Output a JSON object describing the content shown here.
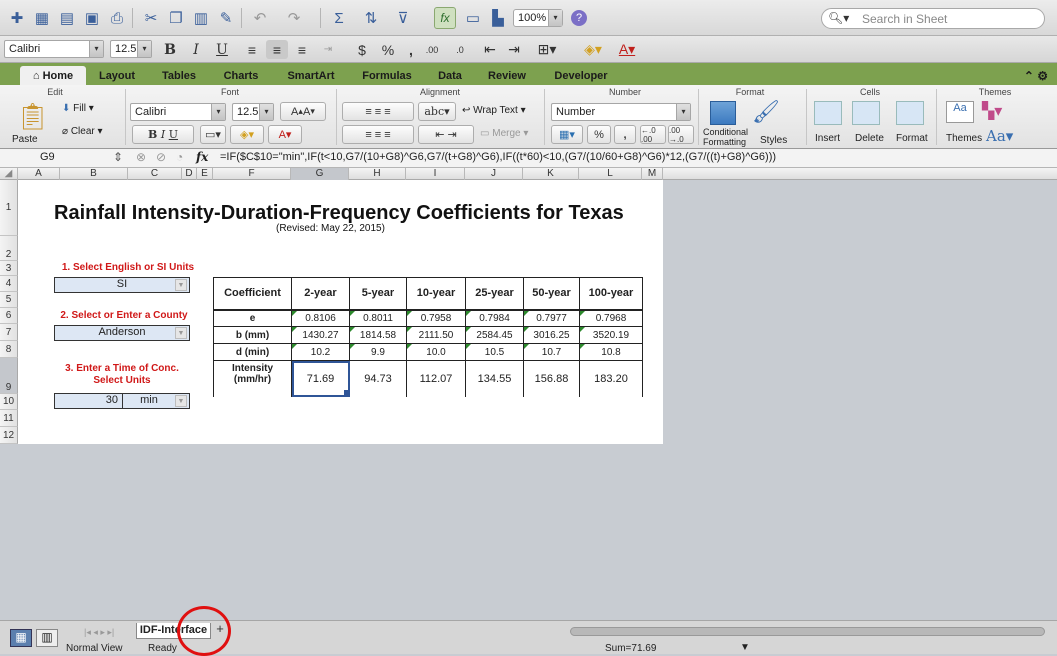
{
  "toolbar": {
    "zoom": "100%",
    "search_placeholder": "Search in Sheet"
  },
  "fontbar": {
    "font": "Calibri",
    "size": "12.5",
    "bold": "B",
    "italic": "I",
    "underline": "U"
  },
  "tabs": [
    "Home",
    "Layout",
    "Tables",
    "Charts",
    "SmartArt",
    "Formulas",
    "Data",
    "Review",
    "Developer"
  ],
  "ribbon": {
    "groups": {
      "edit": "Edit",
      "font": "Font",
      "alignment": "Alignment",
      "number": "Number",
      "format": "Format",
      "cells": "Cells",
      "themes": "Themes"
    },
    "fill": "Fill",
    "clear": "Clear",
    "paste": "Paste",
    "font": "Calibri",
    "size": "12.5",
    "abc": "abc",
    "wrap_text": "Wrap Text",
    "merge": "Merge",
    "number_format": "Number",
    "percent": "%",
    "comma": ",",
    "dec_inc": "←.0 .00",
    "dec_dec": ".00 →.0",
    "conditional": "Conditional Formatting",
    "styles": "Styles",
    "insert": "Insert",
    "delete": "Delete",
    "format": "Format",
    "themes": "Themes",
    "aa": "Aa"
  },
  "formula_bar": {
    "cell_ref": "G9",
    "fx": "fx",
    "formula": "=IF($C$10=\"min\",IF(t<10,G7/(10+G8)^G6,G7/(t+G8)^G6),IF((t*60)<10,(G7/(10/60+G8)^G6)*12,(G7/((t)+G8)^G6)))"
  },
  "columns": [
    "A",
    "B",
    "C",
    "D",
    "E",
    "F",
    "G",
    "H",
    "I",
    "J",
    "K",
    "L",
    "M"
  ],
  "rows": [
    "1",
    "2",
    "3",
    "4",
    "5",
    "6",
    "7",
    "8",
    "9",
    "10",
    "11",
    "12"
  ],
  "sheet": {
    "title": "Rainfall Intensity-Duration-Frequency Coefficients for Texas",
    "revised": "(Revised: May 22, 2015)",
    "step1": "1. Select English or SI Units",
    "units": "SI",
    "step2": "2. Select or Enter a County",
    "county": "Anderson",
    "step3a": "3. Enter a Time of Conc.",
    "step3b": "Select Units",
    "time": "30",
    "time_units": "min",
    "table": {
      "headers": [
        "Coefficient",
        "2-year",
        "5-year",
        "10-year",
        "25-year",
        "50-year",
        "100-year"
      ],
      "rows": [
        {
          "label": "e",
          "values": [
            "0.8106",
            "0.8011",
            "0.7958",
            "0.7984",
            "0.7977",
            "0.7968"
          ]
        },
        {
          "label": "b (mm)",
          "values": [
            "1430.27",
            "1814.58",
            "2111.50",
            "2584.45",
            "3016.25",
            "3520.19"
          ]
        },
        {
          "label": "d (min)",
          "values": [
            "10.2",
            "9.9",
            "10.0",
            "10.5",
            "10.7",
            "10.8"
          ]
        },
        {
          "label": "Intensity (mm/hr)",
          "values": [
            "71.69",
            "94.73",
            "112.07",
            "134.55",
            "156.88",
            "183.20"
          ]
        }
      ]
    }
  },
  "sheet_tab": "IDF-Interface",
  "status": {
    "view": "Normal View",
    "mode": "Ready",
    "sum": "Sum=71.69"
  },
  "colors": {
    "tab_bar": "#7da14f",
    "label_red": "#d01818",
    "input_fill": "#dde7f4",
    "highlight_circle": "#e01010"
  }
}
